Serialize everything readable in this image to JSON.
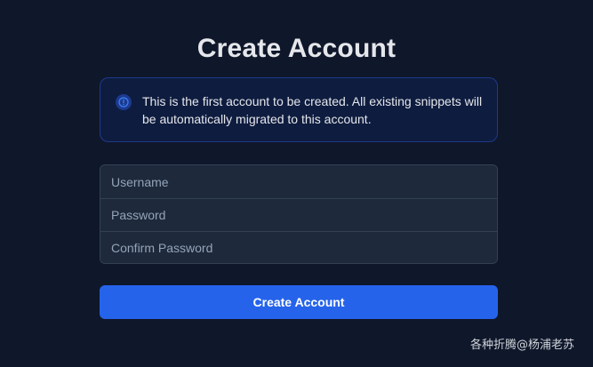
{
  "page": {
    "title": "Create Account"
  },
  "notice": {
    "icon": "info-circle-icon",
    "text": "This is the first account to be created. All existing snippets will be automatically migrated to this account."
  },
  "form": {
    "username": {
      "placeholder": "Username",
      "value": ""
    },
    "password": {
      "placeholder": "Password",
      "value": ""
    },
    "confirm_password": {
      "placeholder": "Confirm Password",
      "value": ""
    },
    "submit_label": "Create Account"
  },
  "watermark": {
    "text": "各种折腾@杨浦老苏"
  },
  "colors": {
    "background": "#0f172a",
    "notice_background": "#0e1c3f",
    "notice_border": "#1e3a8a",
    "field_background": "#1e293b",
    "accent": "#2563eb"
  }
}
